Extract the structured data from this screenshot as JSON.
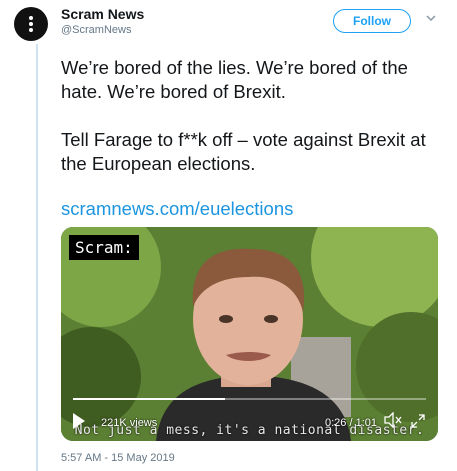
{
  "author": {
    "name": "Scram News",
    "handle": "@ScramNews"
  },
  "follow_label": "Follow",
  "tweet": {
    "text": "We’re bored of the lies. We’re bored of the hate. We’re bored of Brexit.\n\nTell Farage to f**k off – vote against Brexit at the European elections.",
    "link": "scramnews.com/euelections"
  },
  "video": {
    "badge": "Scram:",
    "subtitle": "Not just a mess, it's a national disaster.",
    "views": "221K views",
    "time": "0:26 / 1:01",
    "progress": 0.43
  },
  "timestamp": "5:57 AM - 15 May 2019",
  "colors": {
    "accent": "#1da1f2",
    "link": "#1b95e0",
    "text": "#14171a",
    "muted": "#657786"
  },
  "icons": [
    "avatar-dots-icon",
    "chevron-down-icon",
    "play-icon",
    "mute-icon",
    "expand-icon"
  ]
}
